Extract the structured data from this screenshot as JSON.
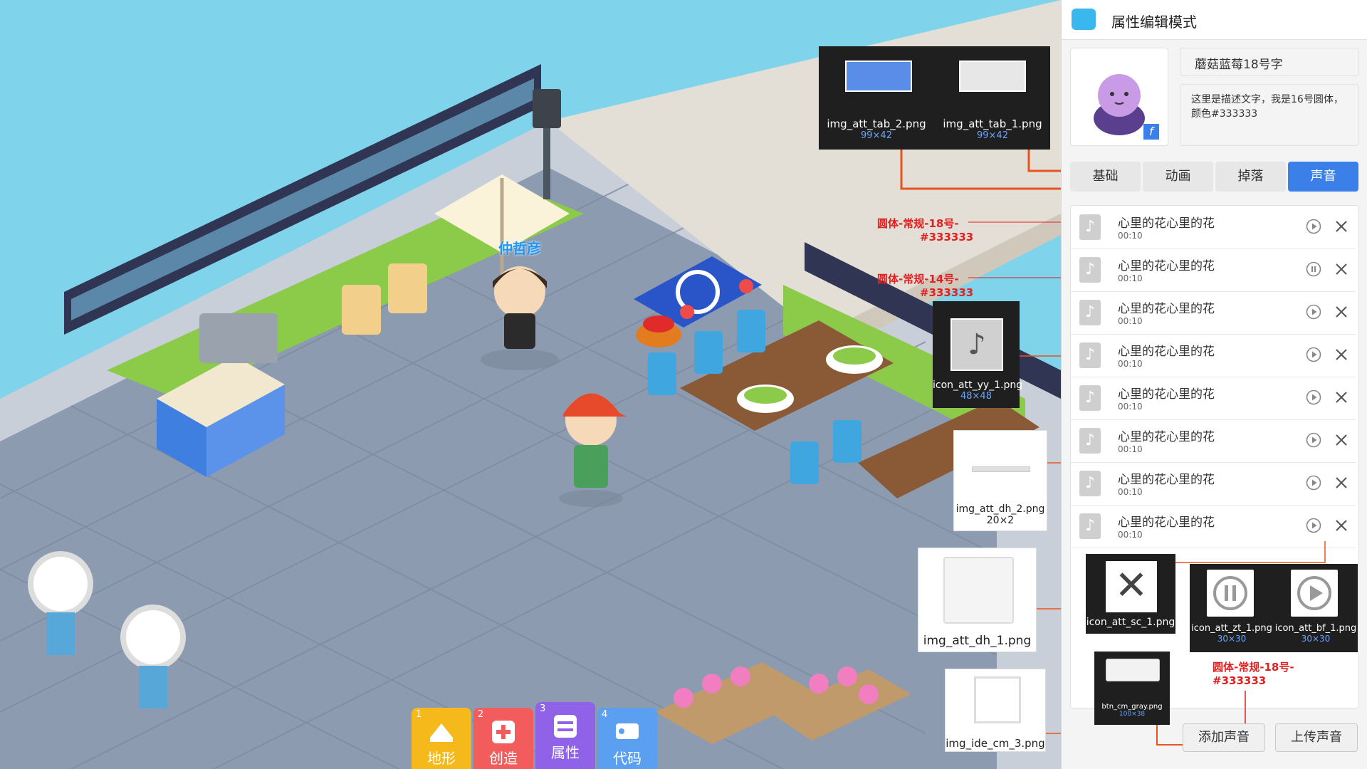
{
  "scene": {
    "character_name": "仲哲彦",
    "toolbar": [
      {
        "num": "1",
        "label": "地形",
        "icon": "terrain-icon",
        "color": "#f6b91c"
      },
      {
        "num": "2",
        "label": "创造",
        "icon": "plus-icon",
        "color": "#f25c5c"
      },
      {
        "num": "3",
        "label": "属性",
        "icon": "sliders-icon",
        "color": "#8f62e8"
      },
      {
        "num": "4",
        "label": "代码",
        "icon": "code-icon",
        "color": "#5a9ff0"
      }
    ]
  },
  "annotations": {
    "tab2": {
      "file": "img_att_tab_2.png",
      "dims": "99×42"
    },
    "tab1": {
      "file": "img_att_tab_1.png",
      "dims": "99×42"
    },
    "yy1": {
      "file": "icon_att_yy_1.png",
      "dims": "48×48"
    },
    "dh2": {
      "file": "img_att_dh_2.png",
      "dims": "20×2"
    },
    "dh1": {
      "file": "img_att_dh_1.png"
    },
    "sc1": {
      "file": "icon_att_sc_1.png"
    },
    "zt1": {
      "file": "icon_att_zt_1.png",
      "dims": "30×30"
    },
    "bf1": {
      "file": "icon_att_bf_1.png",
      "dims": "30×30"
    },
    "btn_gray": {
      "file": "btn_cm_gray.png",
      "dims": "100×38"
    },
    "cm3": {
      "file": "img_ide_cm_3.png"
    },
    "font18_line1": "圆体-常规-18号-",
    "font18_line2": "#333333",
    "font14_line1": "圆体-常规-14号-",
    "font14_line2": "#333333",
    "font18b_line1": "圆体-常规-18号-",
    "font18b_line2": "#333333"
  },
  "panel": {
    "title": "属性编辑模式",
    "name_field": "蘑菇蓝莓18号字",
    "description_line1": "这里是描述文字，我是16号圆体，",
    "description_line2": "颜色#333333",
    "tabs": [
      {
        "label": "基础",
        "active": false
      },
      {
        "label": "动画",
        "active": false
      },
      {
        "label": "掉落",
        "active": false
      },
      {
        "label": "声音",
        "active": true
      }
    ],
    "sounds": [
      {
        "name": "心里的花心里的花",
        "time": "00:10",
        "state": "play"
      },
      {
        "name": "心里的花心里的花",
        "time": "00:10",
        "state": "pause"
      },
      {
        "name": "心里的花心里的花",
        "time": "00:10",
        "state": "play"
      },
      {
        "name": "心里的花心里的花",
        "time": "00:10",
        "state": "play"
      },
      {
        "name": "心里的花心里的花",
        "time": "00:10",
        "state": "play"
      },
      {
        "name": "心里的花心里的花",
        "time": "00:10",
        "state": "play"
      },
      {
        "name": "心里的花心里的花",
        "time": "00:10",
        "state": "play"
      },
      {
        "name": "心里的花心里的花",
        "time": "00:10",
        "state": "play"
      }
    ],
    "add_sound": "添加声音",
    "upload_sound": "上传声音"
  },
  "colors": {
    "accent": "#3a80e8",
    "annotation_red": "#e02020",
    "text": "#333333"
  }
}
